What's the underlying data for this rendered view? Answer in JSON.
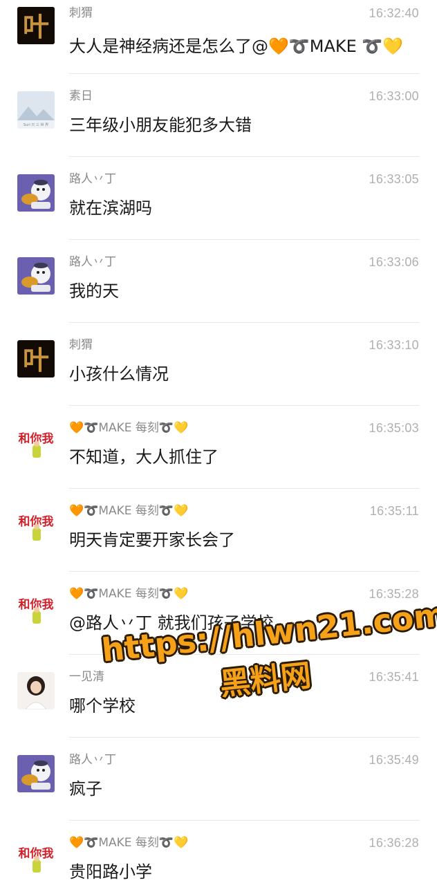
{
  "messages": [
    {
      "sender": "刺猬",
      "time": "16:32:40",
      "text": "大人是神经病还是怎么了@🧡➰MAKE ➰💛"
    },
    {
      "sender": "素日",
      "time": "16:33:00",
      "text": "三年级小朋友能犯多大错"
    },
    {
      "sender": "路人丷丁",
      "time": "16:33:05",
      "text": "就在滨湖吗"
    },
    {
      "sender": "路人丷丁",
      "time": "16:33:06",
      "text": "我的天"
    },
    {
      "sender": "刺猬",
      "time": "16:33:10",
      "text": "小孩什么情况"
    },
    {
      "sender": "🧡➰MAKE 每刻➰💛",
      "time": "16:35:03",
      "text": "不知道，大人抓住了"
    },
    {
      "sender": "🧡➰MAKE 每刻➰💛",
      "time": "16:35:11",
      "text": "明天肯定要开家长会了"
    },
    {
      "sender": "🧡➰MAKE 每刻➰💛",
      "time": "16:35:28",
      "text": "@路人丷丁 就我们孩子学校"
    },
    {
      "sender": "一见清",
      "time": "16:35:41",
      "text": "哪个学校"
    },
    {
      "sender": "路人丷丁",
      "time": "16:35:49",
      "text": "疯子"
    },
    {
      "sender": "🧡➰MAKE 每刻➰💛",
      "time": "16:36:28",
      "text": "贵阳路小学"
    }
  ],
  "avatars": {
    "ye": {
      "char": "叶"
    },
    "suri": {
      "caption": "Suri 只 三 世 界"
    },
    "make": {
      "char": "和你我"
    }
  },
  "watermark": {
    "url": "https://hlwn21.com",
    "subtitle": "黑料网",
    "color": "#f6a11a"
  }
}
